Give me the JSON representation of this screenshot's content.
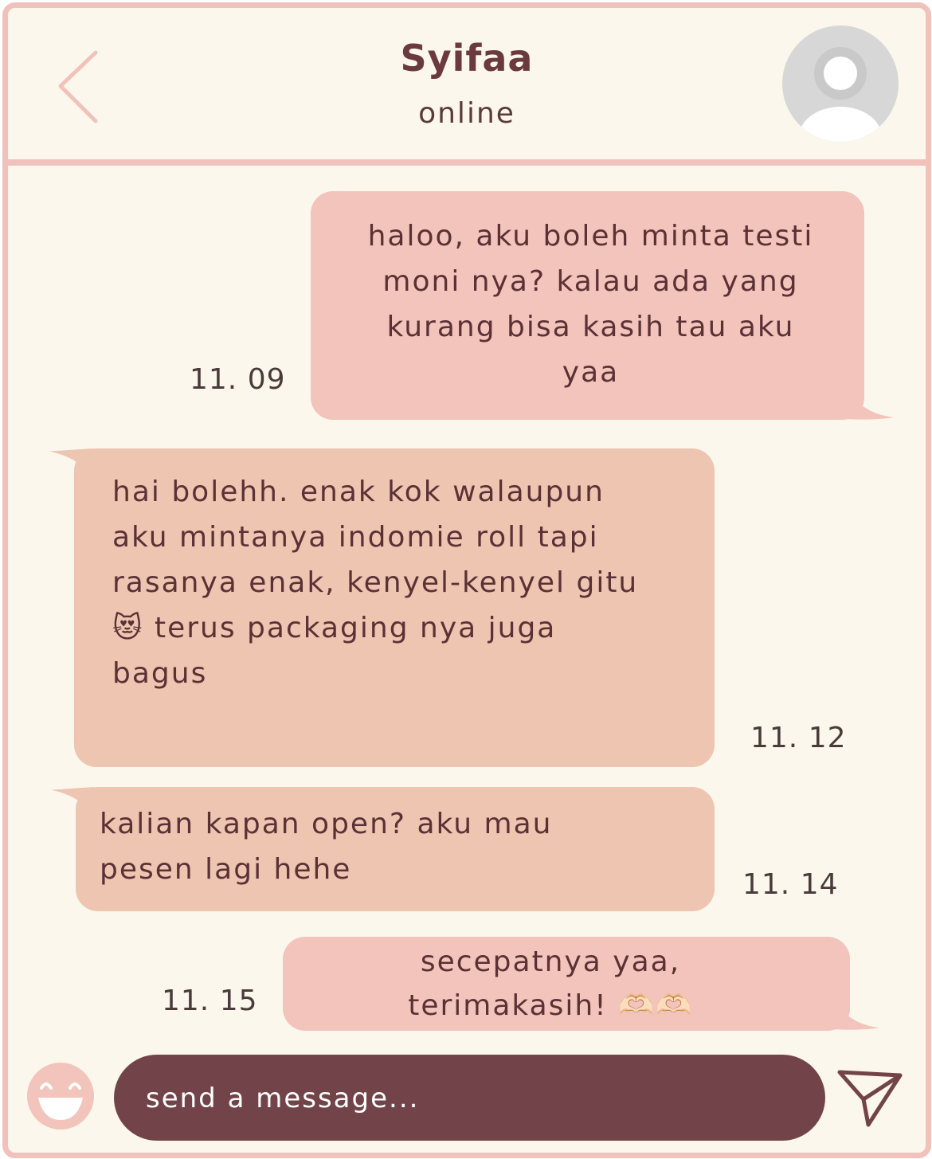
{
  "header": {
    "contact_name": "Syifaa",
    "status": "online"
  },
  "messages": [
    {
      "direction": "outgoing",
      "text": "haloo, aku boleh minta testi moni nya? kalau ada yang kurang bisa kasih tau aku yaa",
      "time": "11. 09"
    },
    {
      "direction": "incoming",
      "text": "hai bolehh. enak kok walaupun aku mintanya indomie roll tapi rasanya enak, kenyel-kenyel gitu😻 terus packaging nya juga bagus",
      "time": "11. 12"
    },
    {
      "direction": "incoming",
      "text": "kalian kapan open? aku mau pesen lagi hehe",
      "time": "11. 14"
    },
    {
      "direction": "outgoing",
      "text": "secepatnya yaa, terimakasih! 🫶🏻🫶🏻",
      "time": "11. 15"
    }
  ],
  "composer": {
    "placeholder": "send a message..."
  },
  "colors": {
    "frame": "#f0c2bb",
    "background": "#fcf7ec",
    "outgoing_bubble": "#f2c4bb",
    "incoming_bubble": "#edc5b0",
    "composer": "#72444a",
    "text": "#5b3136"
  },
  "icons": [
    "chevron-left-icon",
    "avatar-placeholder-icon",
    "smiley-icon",
    "send-icon"
  ]
}
